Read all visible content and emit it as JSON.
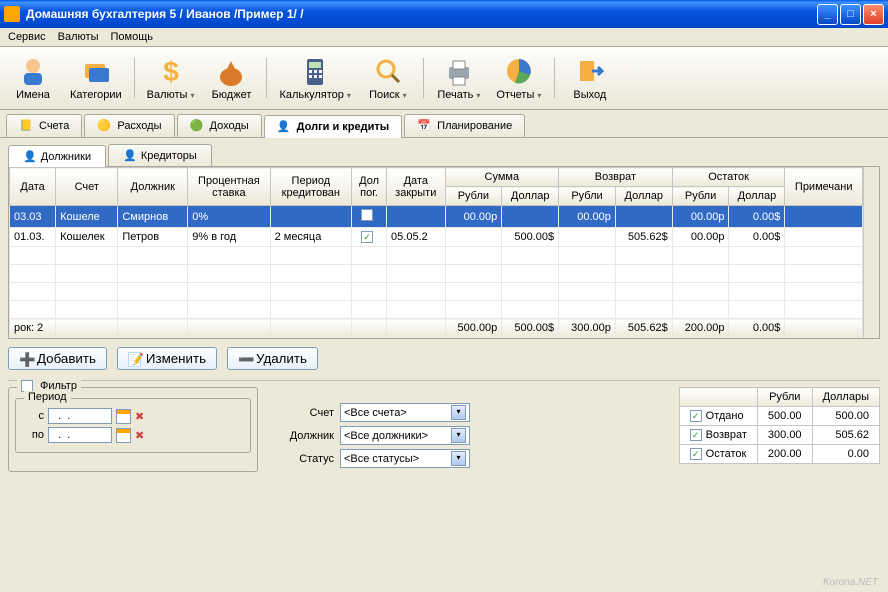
{
  "window": {
    "title": "Домашняя бухгалтерия 5  / Иванов /Пример 1/ /"
  },
  "menu": {
    "service": "Сервис",
    "currency": "Валюты",
    "help": "Помощь"
  },
  "toolbar": {
    "names": "Имена",
    "categories": "Категории",
    "currencies": "Валюты",
    "budget": "Бюджет",
    "calculator": "Калькулятор",
    "search": "Поиск",
    "print": "Печать",
    "reports": "Отчеты",
    "exit": "Выход"
  },
  "mainTabs": {
    "accounts": "Счета",
    "expenses": "Расходы",
    "income": "Доходы",
    "debts": "Долги и кредиты",
    "planning": "Планирование"
  },
  "subTabs": {
    "debtors": "Должники",
    "creditors": "Кредиторы"
  },
  "gridHeaders": {
    "date": "Дата",
    "account": "Счет",
    "debtor": "Должник",
    "rate": "Процентная ставка",
    "period": "Период кредитован",
    "paid": "Дол пог.",
    "closeDate": "Дата закрыти",
    "sum": "Сумма",
    "return": "Возврат",
    "balance": "Остаток",
    "rub": "Рубли",
    "usd": "Доллар",
    "note": "Примечани"
  },
  "rows": [
    {
      "date": "03.03",
      "account": "Кошеле",
      "debtor": "Смирнов",
      "rate": "0%",
      "period": "",
      "paid": false,
      "closeDate": "",
      "sumR": "00.00р",
      "sumU": "",
      "retR": "00.00р",
      "retU": "",
      "balR": "00.00р",
      "balU": "0.00$"
    },
    {
      "date": "01.03.",
      "account": "Кошелек",
      "debtor": "Петров",
      "rate": "9% в год",
      "period": "2 месяца",
      "paid": true,
      "closeDate": "05.05.2",
      "sumR": "",
      "sumU": "500.00$",
      "retR": "",
      "retU": "505.62$",
      "balR": "00.00р",
      "balU": "0.00$"
    }
  ],
  "totals": {
    "prefix": "рок:",
    "count": "2",
    "sumR": "500.00р",
    "sumU": "500.00$",
    "retR": "300.00р",
    "retU": "505.62$",
    "balR": "200.00р",
    "balU": "0.00$"
  },
  "buttons": {
    "add": "Добавить",
    "edit": "Изменить",
    "del": "Удалить"
  },
  "filter": {
    "label": "Фильтр",
    "period": "Период",
    "from": "с",
    "to": "по",
    "dateFrom": "  .  .",
    "dateTo": "  .  .",
    "account": "Счет",
    "debtor": "Должник",
    "status": "Статус",
    "allAccounts": "<Все счета>",
    "allDebtors": "<Все должники>",
    "allStatuses": "<Все статусы>"
  },
  "summary": {
    "rub": "Рубли",
    "usd": "Доллары",
    "given": "Отдано",
    "givenR": "500.00",
    "givenU": "500.00",
    "returned": "Возврат",
    "returnedR": "300.00",
    "returnedU": "505.62",
    "balance": "Остаток",
    "balanceR": "200.00",
    "balanceU": "0.00"
  },
  "watermark": "Korona.NET"
}
